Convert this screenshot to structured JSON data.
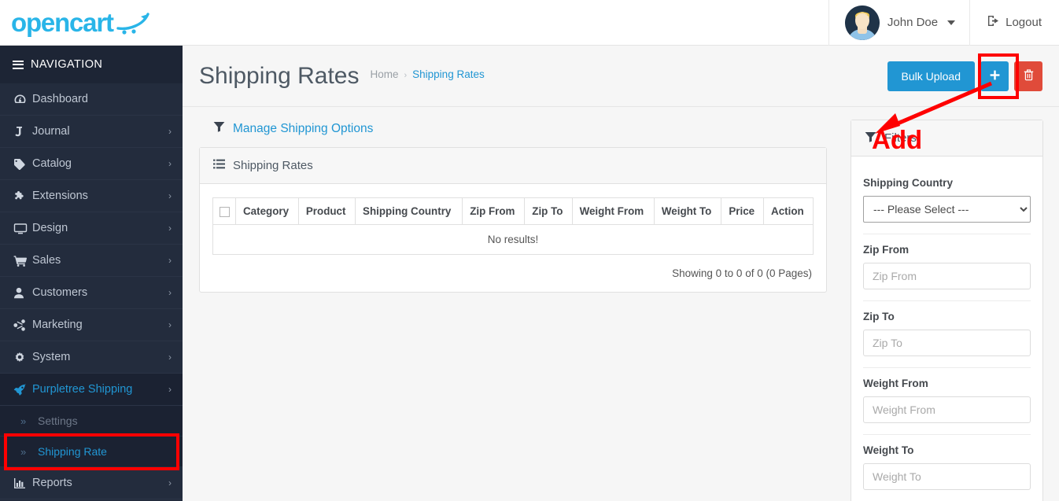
{
  "header": {
    "brand": "opencart",
    "brand_icon": "cart-swoosh-icon",
    "user_name": "John Doe",
    "logout_label": "Logout",
    "avatar_icon": "user-avatar",
    "accent_color": "#2196d3",
    "brand_color": "#29b5e8"
  },
  "sidebar": {
    "nav_header": "NAVIGATION",
    "items": [
      {
        "label": "Dashboard",
        "icon": "dashboard-icon",
        "arrow": "",
        "active": false
      },
      {
        "label": "Journal",
        "icon": "journal-icon",
        "arrow": "›",
        "active": false
      },
      {
        "label": "Catalog",
        "icon": "tag-icon",
        "arrow": "›",
        "active": false
      },
      {
        "label": "Extensions",
        "icon": "puzzle-icon",
        "arrow": "›",
        "active": false
      },
      {
        "label": "Design",
        "icon": "monitor-icon",
        "arrow": "›",
        "active": false
      },
      {
        "label": "Sales",
        "icon": "cart-icon",
        "arrow": "›",
        "active": false
      },
      {
        "label": "Customers",
        "icon": "user-icon",
        "arrow": "›",
        "active": false
      },
      {
        "label": "Marketing",
        "icon": "share-icon",
        "arrow": "›",
        "active": false
      },
      {
        "label": "System",
        "icon": "gear-icon",
        "arrow": "›",
        "active": false
      },
      {
        "label": "Purpletree Shipping",
        "icon": "rocket-icon",
        "arrow": "›",
        "active": true
      }
    ],
    "subitems": [
      {
        "label": "Settings",
        "bullet": "»",
        "highlighted": false
      },
      {
        "label": "Shipping Rate",
        "bullet": "»",
        "highlighted": true
      }
    ],
    "items_after": [
      {
        "label": "Reports",
        "icon": "bar-chart-icon",
        "arrow": "›",
        "active": false
      }
    ]
  },
  "page": {
    "title": "Shipping Rates",
    "breadcrumb": [
      {
        "label": "Home",
        "current": false
      },
      {
        "label": "Shipping Rates",
        "current": true
      }
    ],
    "breadcrumb_separator": "›",
    "buttons": {
      "bulk_upload": "Bulk Upload",
      "add": "+",
      "add_icon": "plus-icon",
      "delete_icon": "trash-icon"
    }
  },
  "annotation": {
    "label": "Add",
    "color": "#fe0000"
  },
  "manage_link": {
    "label": "Manage Shipping Options",
    "icon": "filter-icon"
  },
  "rates_card": {
    "title": "Shipping Rates",
    "icon": "list-icon",
    "columns": [
      "",
      "Category",
      "Product",
      "Shipping Country",
      "Zip From",
      "Zip To",
      "Weight From",
      "Weight To",
      "Price",
      "Action"
    ],
    "rows": [],
    "empty_text": "No results!",
    "paging_text": "Showing 0 to 0 of 0 (0 Pages)"
  },
  "filters": {
    "title": "Filters",
    "icon": "filter-icon",
    "fields": [
      {
        "label": "Shipping Country",
        "type": "select",
        "value": "--- Please Select ---",
        "options": [
          "--- Please Select ---"
        ]
      },
      {
        "label": "Zip From",
        "type": "text",
        "value": "",
        "placeholder": "Zip From"
      },
      {
        "label": "Zip To",
        "type": "text",
        "value": "",
        "placeholder": "Zip To"
      },
      {
        "label": "Weight From",
        "type": "text",
        "value": "",
        "placeholder": "Weight From"
      },
      {
        "label": "Weight To",
        "type": "text",
        "value": "",
        "placeholder": "Weight To"
      }
    ]
  }
}
